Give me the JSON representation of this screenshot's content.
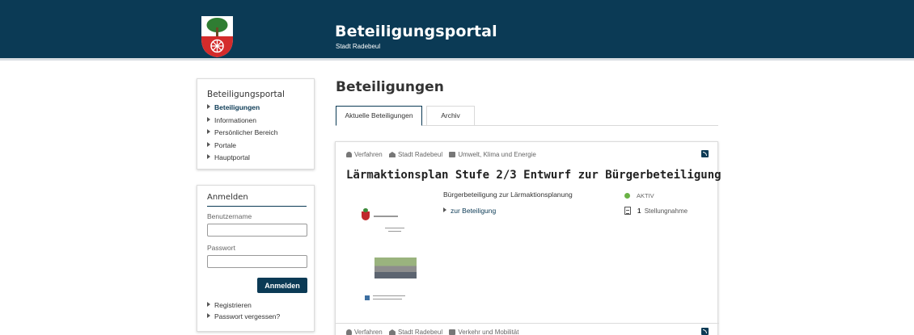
{
  "header": {
    "title": "Beteiligungsportal",
    "subtitle": "Stadt Radebeul",
    "brand_color": "#0b3a55"
  },
  "sidebar": {
    "title": "Beteiligungsportal",
    "items": [
      {
        "label": "Beteiligungen",
        "active": true
      },
      {
        "label": "Informationen"
      },
      {
        "label": "Persönlicher Bereich"
      },
      {
        "label": "Portale"
      },
      {
        "label": "Hauptportal"
      }
    ]
  },
  "login": {
    "title": "Anmelden",
    "username_label": "Benutzername",
    "username_value": "",
    "password_label": "Passwort",
    "password_value": "",
    "submit_label": "Anmelden",
    "links": [
      "Registrieren",
      "Passwort vergessen?"
    ]
  },
  "main": {
    "title": "Beteiligungen",
    "tabs": [
      {
        "label": "Aktuelle Beteiligungen",
        "active": true
      },
      {
        "label": "Archiv"
      }
    ],
    "cards": [
      {
        "meta": {
          "type": "Verfahren",
          "org": "Stadt Radebeul",
          "category": "Umwelt, Klima und Energie"
        },
        "title": "Lärmaktionsplan Stufe 2/3 Entwurf zur Bürgerbeteiligung",
        "description": "Bürgerbeteiligung zur Lärmaktionsplanung",
        "link": "zur Beteiligung",
        "status": "AKTIV",
        "status_color": "#6ab245",
        "statements_count": "1",
        "statements_label": "Stellungnahme"
      },
      {
        "meta": {
          "type": "Verfahren",
          "org": "Stadt Radebeul",
          "category": "Verkehr und Mobilität"
        }
      }
    ]
  },
  "icons": [
    "coat-of-arms-logo",
    "tree-icon",
    "town-hall-icon",
    "folder-icon",
    "rss-icon",
    "document-icon",
    "status-dot-icon"
  ]
}
